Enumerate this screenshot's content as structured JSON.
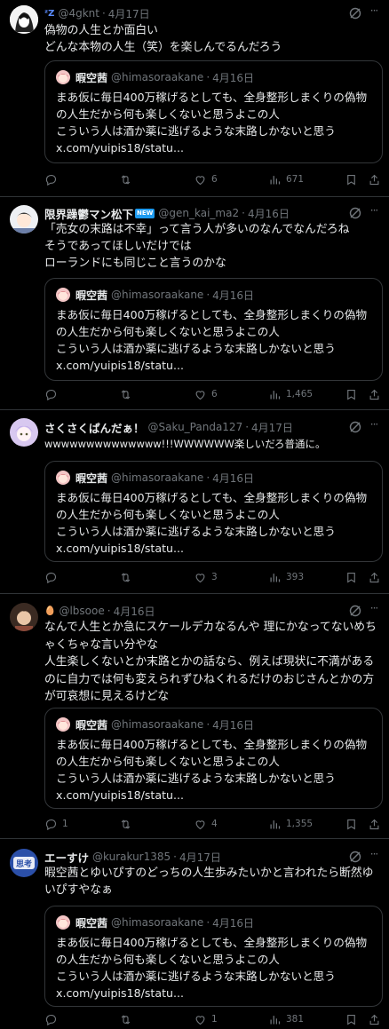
{
  "quote": {
    "name": "暇空茜",
    "handle": "@himasoraakane",
    "date": "4月16日",
    "text": "まあ仮に毎日400万稼げるとしても、全身整形しまくりの偽物の人生だから何も楽しくないと思うよこの人\nこういう人は酒か薬に逃げるような末路しかないと思う\nx.com/yuipis18/statu..."
  },
  "tweets": [
    {
      "name": "",
      "name_emoji": "💤",
      "handle": "@4gknt",
      "date": "4月17日",
      "text": "偽物の人生とか面白い\nどんな本物の人生（笑）を楽しんでるんだろう",
      "replies": "",
      "reposts": "",
      "likes": "6",
      "views": "671"
    },
    {
      "name": "限界躁鬱マン松下",
      "badge": "NEW",
      "handle": "@gen_kai_ma2",
      "date": "4月16日",
      "text": "「売女の末路は不幸」って言う人が多いのなんでなんだろね\nそうであってほしいだけでは\nローランドにも同じこと言うのかな",
      "replies": "",
      "reposts": "",
      "likes": "6",
      "views": "1,465"
    },
    {
      "name": "さくさくぱんだぁ！",
      "handle": "@Saku_Panda127",
      "date": "4月17日",
      "text": "wwwwwwwwwwwwww!!!WWWWWW楽しいだろ普通に。",
      "replies": "",
      "reposts": "",
      "likes": "3",
      "views": "393"
    },
    {
      "name": "🥚",
      "handle": "@lbsooe",
      "date": "4月16日",
      "text": "なんで人生とか急にスケールデカなるんや 理にかなってないめちゃくちゃな言い分やな\n人生楽しくないとか末路とかの話なら、例えば現状に不満があるのに自力では何も変えられずひねくれるだけのおじさんとかの方が可哀想に見えるけどな",
      "replies": "1",
      "reposts": "",
      "likes": "4",
      "views": "1,355"
    },
    {
      "name": "エーすけ",
      "handle": "@kurakur1385",
      "date": "4月17日",
      "text": "暇空茜とゆいぴすのどっちの人生歩みたいかと言われたら断然ゆいぴすやなぁ",
      "replies": "",
      "reposts": "",
      "likes": "1",
      "views": "381"
    }
  ],
  "icons": [
    "reply-icon",
    "repost-icon",
    "like-icon",
    "views-icon",
    "bookmark-icon",
    "share-icon",
    "grok-icon",
    "more-icon"
  ],
  "colors": {
    "background": "#000000",
    "text": "#e7e9ea",
    "muted": "#71767b",
    "border": "#2f3336",
    "badge": "#1d9bf0"
  }
}
